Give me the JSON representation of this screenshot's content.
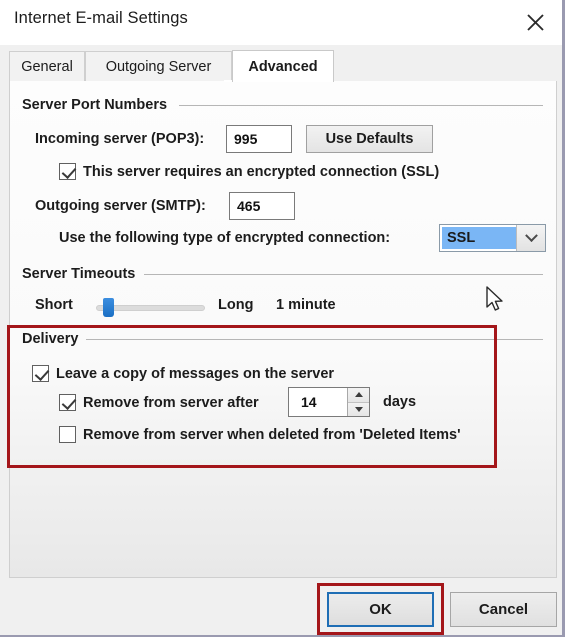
{
  "window": {
    "title": "Internet E-mail Settings",
    "close_icon": "close-icon"
  },
  "tabs": [
    {
      "id": "general",
      "label": "General",
      "active": false
    },
    {
      "id": "outgoing",
      "label": "Outgoing Server",
      "active": false
    },
    {
      "id": "advanced",
      "label": "Advanced",
      "active": true
    }
  ],
  "server_port_numbers": {
    "group_title": "Server Port Numbers",
    "incoming_label": "Incoming server (POP3):",
    "incoming_value": "995",
    "use_defaults_label": "Use Defaults",
    "ssl_checkbox_label": "This server requires an encrypted connection (SSL)",
    "ssl_checkbox_checked": true,
    "outgoing_label": "Outgoing server (SMTP):",
    "outgoing_value": "465",
    "encryption_label": "Use the following type of encrypted connection:",
    "encryption_value": "SSL"
  },
  "server_timeouts": {
    "group_title": "Server Timeouts",
    "short_label": "Short",
    "long_label": "Long",
    "value_label": "1 minute",
    "slider_percent": 7
  },
  "delivery": {
    "group_title": "Delivery",
    "leave_copy_label": "Leave a copy of messages on the server",
    "leave_copy_checked": true,
    "remove_after_label": "Remove from server after",
    "remove_after_checked": true,
    "days_value": "14",
    "days_unit_label": "days",
    "remove_deleted_label": "Remove from server when deleted from 'Deleted Items'",
    "remove_deleted_checked": false
  },
  "footer": {
    "ok_label": "OK",
    "cancel_label": "Cancel"
  },
  "annotations": {
    "accent_color": "#a4161a",
    "highlight_color": "#7ab6f5",
    "focus_color": "#1f6eb5"
  }
}
